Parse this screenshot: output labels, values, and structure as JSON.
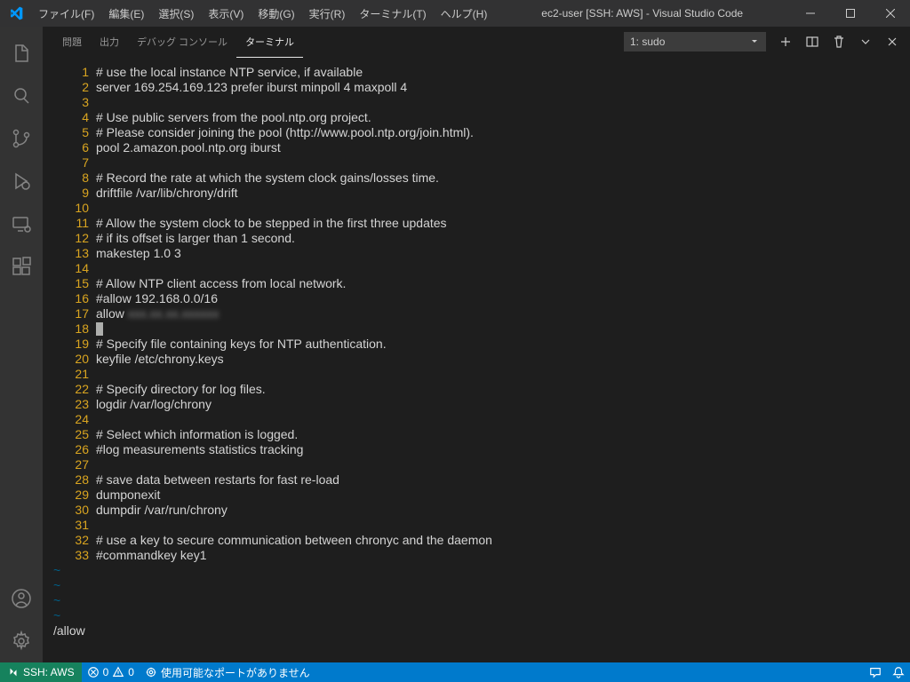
{
  "titlebar": {
    "menus": [
      "ファイル(F)",
      "編集(E)",
      "選択(S)",
      "表示(V)",
      "移動(G)",
      "実行(R)",
      "ターミナル(T)",
      "ヘルプ(H)"
    ],
    "title": "ec2-user [SSH: AWS] - Visual Studio Code"
  },
  "panel": {
    "tabs": [
      "問題",
      "出力",
      "デバッグ コンソール",
      "ターミナル"
    ],
    "active_tab_index": 3,
    "terminal_selector": "1: sudo"
  },
  "terminal": {
    "lines": [
      {
        "n": 1,
        "t": "# use the local instance NTP service, if available"
      },
      {
        "n": 2,
        "t": "server 169.254.169.123 prefer iburst minpoll 4 maxpoll 4"
      },
      {
        "n": 3,
        "t": ""
      },
      {
        "n": 4,
        "t": "# Use public servers from the pool.ntp.org project."
      },
      {
        "n": 5,
        "t": "# Please consider joining the pool (http://www.pool.ntp.org/join.html)."
      },
      {
        "n": 6,
        "t": "pool 2.amazon.pool.ntp.org iburst"
      },
      {
        "n": 7,
        "t": ""
      },
      {
        "n": 8,
        "t": "# Record the rate at which the system clock gains/losses time."
      },
      {
        "n": 9,
        "t": "driftfile /var/lib/chrony/drift"
      },
      {
        "n": 10,
        "t": ""
      },
      {
        "n": 11,
        "t": "# Allow the system clock to be stepped in the first three updates"
      },
      {
        "n": 12,
        "t": "# if its offset is larger than 1 second."
      },
      {
        "n": 13,
        "t": "makestep 1.0 3"
      },
      {
        "n": 14,
        "t": ""
      },
      {
        "n": 15,
        "t": "# Allow NTP client access from local network."
      },
      {
        "n": 16,
        "t": "#allow 192.168.0.0/16"
      },
      {
        "n": 17,
        "t": "allow ",
        "redacted": "xxx.xx.xx.xxxxxx"
      },
      {
        "n": 18,
        "t": "",
        "cursor": true
      },
      {
        "n": 19,
        "t": "# Specify file containing keys for NTP authentication."
      },
      {
        "n": 20,
        "t": "keyfile /etc/chrony.keys"
      },
      {
        "n": 21,
        "t": ""
      },
      {
        "n": 22,
        "t": "# Specify directory for log files."
      },
      {
        "n": 23,
        "t": "logdir /var/log/chrony"
      },
      {
        "n": 24,
        "t": ""
      },
      {
        "n": 25,
        "t": "# Select which information is logged."
      },
      {
        "n": 26,
        "t": "#log measurements statistics tracking"
      },
      {
        "n": 27,
        "t": ""
      },
      {
        "n": 28,
        "t": "# save data between restarts for fast re-load"
      },
      {
        "n": 29,
        "t": "dumponexit"
      },
      {
        "n": 30,
        "t": "dumpdir /var/run/chrony"
      },
      {
        "n": 31,
        "t": ""
      },
      {
        "n": 32,
        "t": "# use a key to secure communication between chronyc and the daemon"
      },
      {
        "n": 33,
        "t": "#commandkey key1"
      }
    ],
    "tildes": [
      "~",
      "~",
      "~",
      "~"
    ],
    "vim_status": "/allow"
  },
  "statusbar": {
    "remote": "SSH: AWS",
    "errors": "0",
    "warnings": "0",
    "ports": "使用可能なポートがありません"
  }
}
